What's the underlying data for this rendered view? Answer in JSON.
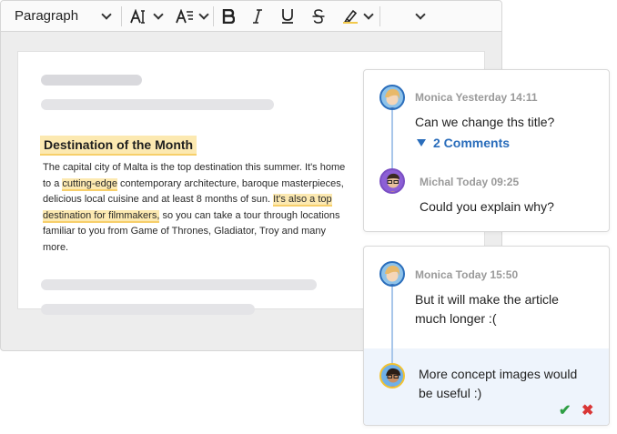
{
  "toolbar": {
    "paragraph_label": "Paragraph"
  },
  "document": {
    "heading": "Destination of the Month",
    "body": {
      "p1": "The capital city of Malta is the top destination this summer. It's home to a ",
      "hl1": "cutting-edge",
      "p2": " contemporary architecture, baroque masterpieces, delicious local cuisine and at least 8 months of sun. ",
      "hl2": "It's also a top destination for filmmakers,",
      "p3": " so you can take a tour through locations familiar to you from Game of Thrones, Gladiator, Troy and many more."
    }
  },
  "threads": [
    {
      "comments": [
        {
          "author": "Monica Yesterday 14:11",
          "text": "Can we change ths title?"
        },
        {
          "author": "Michal Today 09:25",
          "text": "Could you explain why?"
        }
      ],
      "toggle_label": "2 Comments"
    },
    {
      "comments": [
        {
          "author": "Monica Today 15:50",
          "text": "But it will make the article much longer :("
        },
        {
          "author": "",
          "text": "More concept images would be useful :)"
        }
      ],
      "accept_glyph": "✔",
      "reject_glyph": "✖"
    }
  ],
  "colors": {
    "accent": "#2a6dbb",
    "highlight": "#fce9b1",
    "accept": "#2e9e44",
    "reject": "#d93636"
  }
}
